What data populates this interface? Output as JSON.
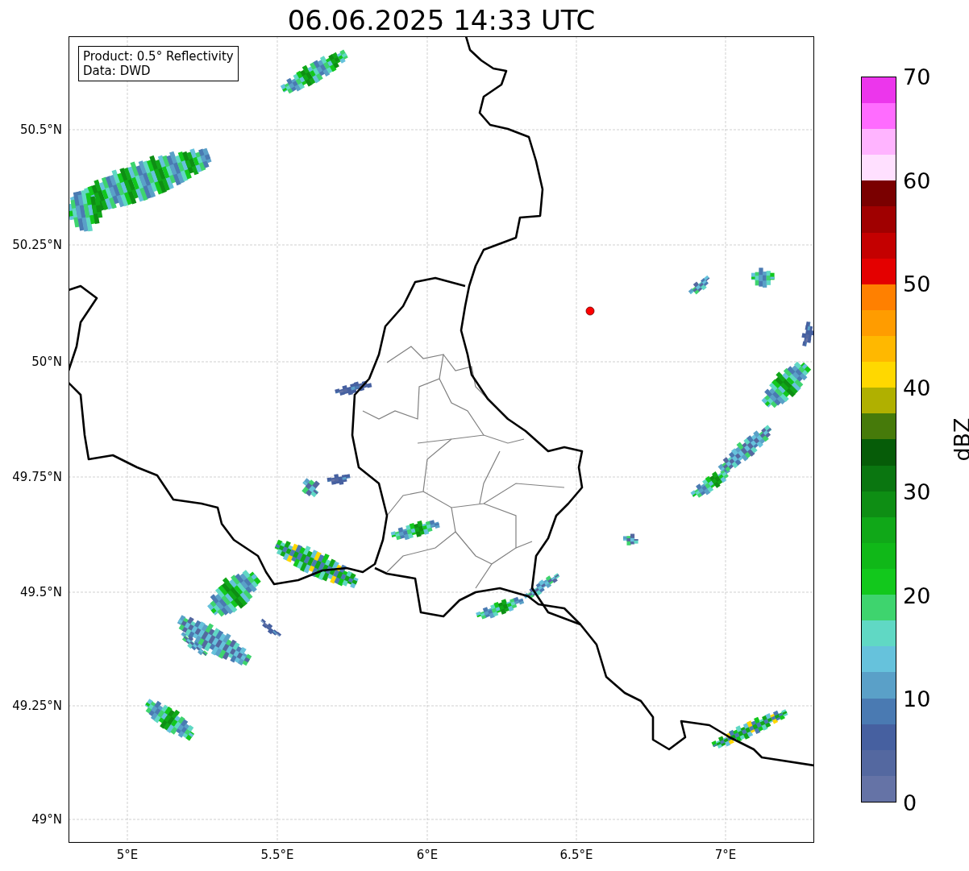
{
  "title": "06.06.2025 14:33 UTC",
  "legend": [
    "Product: 0.5° Reflectivity",
    "Data: DWD"
  ],
  "x_ticks": [
    "5°E",
    "5.5°E",
    "6°E",
    "6.5°E",
    "7°E"
  ],
  "y_ticks": [
    "50.5°N",
    "50.25°N",
    "50°N",
    "49.75°N",
    "49.5°N",
    "49.25°N",
    "49°N"
  ],
  "colorbar": {
    "label": "dBZ",
    "ticks": [
      "70",
      "60",
      "50",
      "40",
      "30",
      "20",
      "10",
      "0"
    ],
    "segments": [
      {
        "color": "#6573a6"
      },
      {
        "color": "#5468a0"
      },
      {
        "color": "#4660a0"
      },
      {
        "color": "#4a7ab2"
      },
      {
        "color": "#5aa0c8"
      },
      {
        "color": "#66c2dc"
      },
      {
        "color": "#60d8c4"
      },
      {
        "color": "#3ed46e"
      },
      {
        "color": "#12c81c"
      },
      {
        "color": "#10b818"
      },
      {
        "color": "#10a818"
      },
      {
        "color": "#0e8e14"
      },
      {
        "color": "#0a7610"
      },
      {
        "color": "#065c08"
      },
      {
        "color": "#467a0a"
      },
      {
        "color": "#b0b000"
      },
      {
        "color": "#ffd800"
      },
      {
        "color": "#ffb800"
      },
      {
        "color": "#ff9c00"
      },
      {
        "color": "#ff8000"
      },
      {
        "color": "#e40000"
      },
      {
        "color": "#c40000"
      },
      {
        "color": "#a00000"
      },
      {
        "color": "#7a0000"
      },
      {
        "color": "#ffe0ff"
      },
      {
        "color": "#ffb4ff"
      },
      {
        "color": "#ff6cff"
      },
      {
        "color": "#ec36ec"
      }
    ]
  }
}
